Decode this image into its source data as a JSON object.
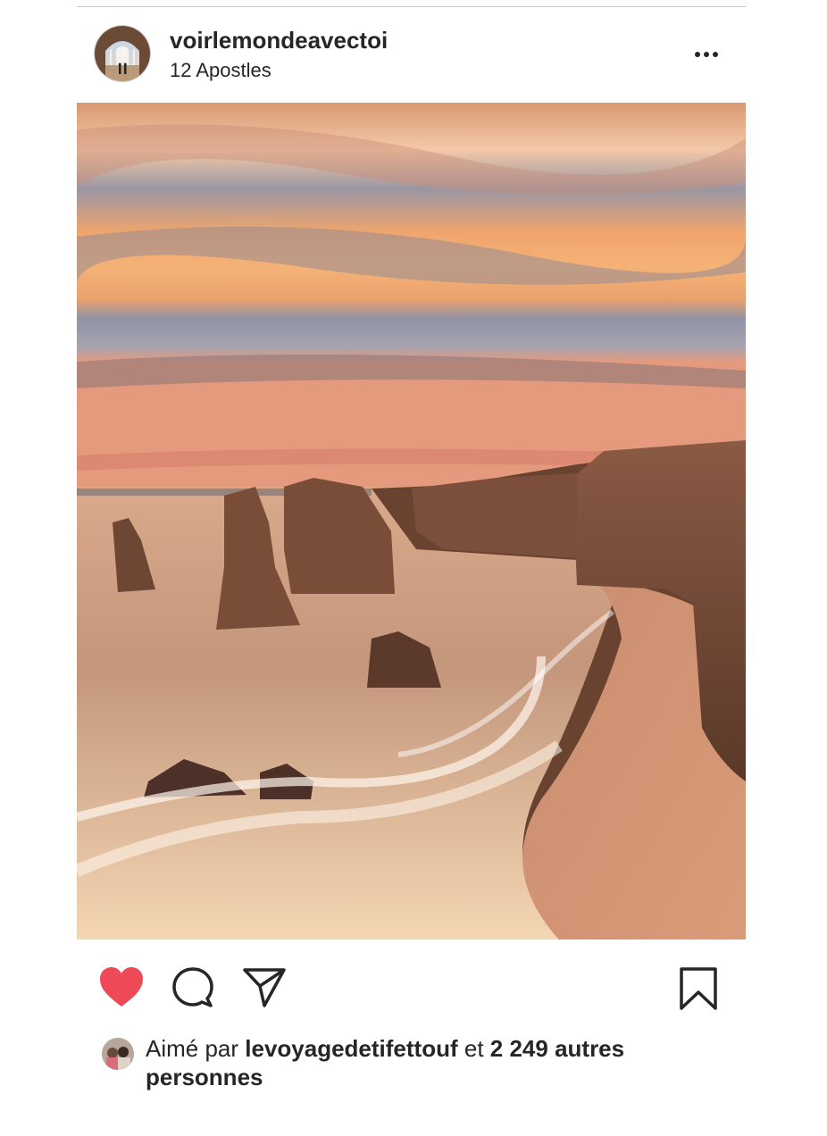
{
  "post": {
    "username": "voirlemondeavectoi",
    "location": "12 Apostles",
    "likes": {
      "prefix": "Aimé par ",
      "liker": "levoyagedetifettouf",
      "joiner": " et ",
      "count_text": "2 249 autres personnes"
    }
  },
  "icons": {
    "like": "heart-icon",
    "comment": "comment-icon",
    "share": "paper-plane-icon",
    "save": "bookmark-icon",
    "more": "more-options-icon"
  },
  "colors": {
    "like_red": "#ED4956",
    "text": "#262626"
  }
}
